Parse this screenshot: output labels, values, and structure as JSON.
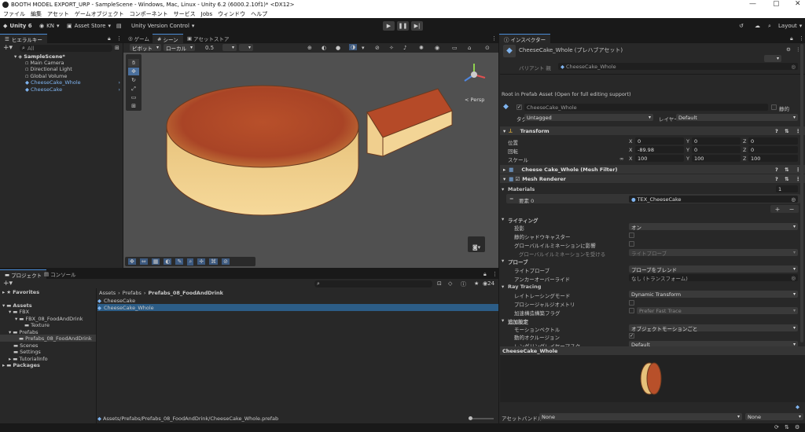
{
  "window": {
    "title": "BOOTH MODEL EXPORT_URP - SampleScene - Windows, Mac, Linux - Unity 6.2 (6000.2.10f1)* <DX12>"
  },
  "menu": [
    "ファイル",
    "編集",
    "アセット",
    "ゲームオブジェクト",
    "コンポーネント",
    "サービス",
    "Jobs",
    "ウィンドウ",
    "ヘルプ"
  ],
  "toolbar": {
    "unity": "Unity 6",
    "account": "KN",
    "asset_store": "Asset Store",
    "version_control": "Unity Version Control",
    "layout": "Layout"
  },
  "hierarchy": {
    "tab": "ヒエラルキー",
    "search_placeholder": "All",
    "scene": "SampleScene*",
    "items": [
      "Main Camera",
      "Directional Light",
      "Global Volume",
      "CheeseCake_Whole",
      "CheeseCake"
    ]
  },
  "scene_view": {
    "tabs": [
      "ゲーム",
      "シーン",
      "アセットストア"
    ],
    "pivot": "ピボット",
    "space": "ローカル",
    "snap": "0.5",
    "persp": "< Persp"
  },
  "project": {
    "tabs": [
      "プロジェクト",
      "コンソール"
    ],
    "count": "24",
    "favorites": "Favorites",
    "tree": [
      "Assets",
      "FBX",
      "FBX_08_FoodAndDrink",
      "Texture",
      "Prefabs",
      "Prefabs_08_FoodAndDrink",
      "Scenes",
      "Settings",
      "TutorialInfo",
      "Packages"
    ],
    "breadcrumb": [
      "Assets",
      "Prefabs",
      "Prefabs_08_FoodAndDrink"
    ],
    "files": [
      "CheeseCake",
      "CheeseCake_Whole"
    ],
    "path": "Assets/Prefabs/Prefabs_08_FoodAndDrink/CheeseCake_Whole.prefab"
  },
  "inspector": {
    "tab": "インスペクター",
    "asset_name": "CheeseCake_Whole (プレハブアセット)",
    "variant_label": "バリアント 親",
    "variant_value": "CheeseCake_Whole",
    "root_note": "Root in Prefab Asset (Open for full editing support)",
    "object_name": "CheeseCake_Whole",
    "static": "静的",
    "tag_label": "タグ",
    "tag_value": "Untagged",
    "layer_label": "レイヤー",
    "layer_value": "Default",
    "transform": {
      "title": "Transform",
      "pos_label": "位置",
      "rot_label": "回転",
      "scale_label": "スケール",
      "pos": {
        "x": "0",
        "y": "0",
        "z": "0"
      },
      "rot": {
        "x": "-89.98",
        "y": "0",
        "z": "0"
      },
      "scale": {
        "x": "100",
        "y": "100",
        "z": "100"
      }
    },
    "mesh_filter": "Cheese Cake_Whole (Mesh Filter)",
    "mesh_renderer": "Mesh Renderer",
    "materials": {
      "label": "Materials",
      "count": "1",
      "element": "要素 0",
      "value": "TEX_CheeseCake"
    },
    "lighting": {
      "title": "ライティング",
      "cast_shadows": "投影",
      "cast_shadows_value": "オン",
      "static_shadow": "静的シャドウキャスター",
      "contribute_gi": "グローバルイルミネーションに影響",
      "receive_gi": "グローバルイルミネーションを受ける",
      "receive_gi_value": "ライトプローブ"
    },
    "probes": {
      "title": "プローブ",
      "light_probes": "ライトプローブ",
      "light_probes_value": "プローブをブレンド",
      "anchor": "アンカーオーバーライド",
      "anchor_value": "なし (トランスフォーム)"
    },
    "ray_tracing": {
      "title": "Ray Tracing",
      "mode": "レイトレーシングモード",
      "mode_value": "Dynamic Transform",
      "procedural": "プロシージャルジオメトリ",
      "accel": "加速構造構築フラグ",
      "accel_value": "Prefer Fast Trace"
    },
    "additional": {
      "title": "追加設定",
      "motion": "モーションベクトル",
      "motion_value": "オブジェクトモーションごと",
      "dynamic_occlusion": "動的オクルージョン",
      "rendering_layer": "レンダリングレイヤーマスク",
      "rendering_layer_value": "Default"
    },
    "preview_title": "CheeseCake_Whole",
    "asset_bundle_label": "アセットバンドル",
    "asset_bundle_value": "None",
    "asset_bundle_variant": "None"
  },
  "colors": {
    "accent": "#4a8bd6",
    "selection": "#2c5d87",
    "panel": "#282828",
    "cake_top": "#b8502a",
    "cake_side": "#f0cf8e"
  }
}
